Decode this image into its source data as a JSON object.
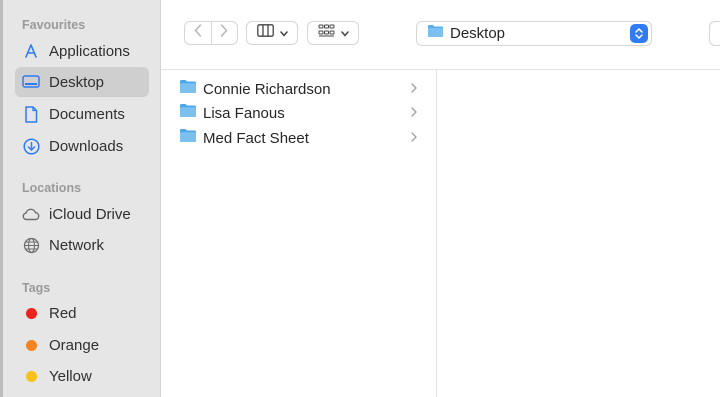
{
  "sidebar": {
    "favourites_title": "Favourites",
    "favourites": [
      {
        "label": "Applications",
        "icon": "applications-icon"
      },
      {
        "label": "Desktop",
        "icon": "desktop-icon",
        "selected": true
      },
      {
        "label": "Documents",
        "icon": "document-icon"
      },
      {
        "label": "Downloads",
        "icon": "download-icon"
      }
    ],
    "locations_title": "Locations",
    "locations": [
      {
        "label": "iCloud Drive",
        "icon": "cloud-icon"
      },
      {
        "label": "Network",
        "icon": "globe-icon"
      }
    ],
    "tags_title": "Tags",
    "tags": [
      {
        "label": "Red",
        "color": "#f0221c"
      },
      {
        "label": "Orange",
        "color": "#f5831f"
      },
      {
        "label": "Yellow",
        "color": "#f4c21b"
      }
    ]
  },
  "toolbar": {
    "back_icon": "chevron-left-icon",
    "forward_icon": "chevron-right-icon",
    "view_icon": "columns-view-icon",
    "group_icon": "grid-group-icon",
    "path_title": "Desktop"
  },
  "column": {
    "items": [
      {
        "name": "Connie Richardson"
      },
      {
        "name": "Lisa Fanous"
      },
      {
        "name": "Med Fact Sheet"
      }
    ]
  },
  "colors": {
    "accent": "#2f7cf6",
    "sidebar_icon": "#2f7cf6",
    "folder": "#5aaee8"
  }
}
